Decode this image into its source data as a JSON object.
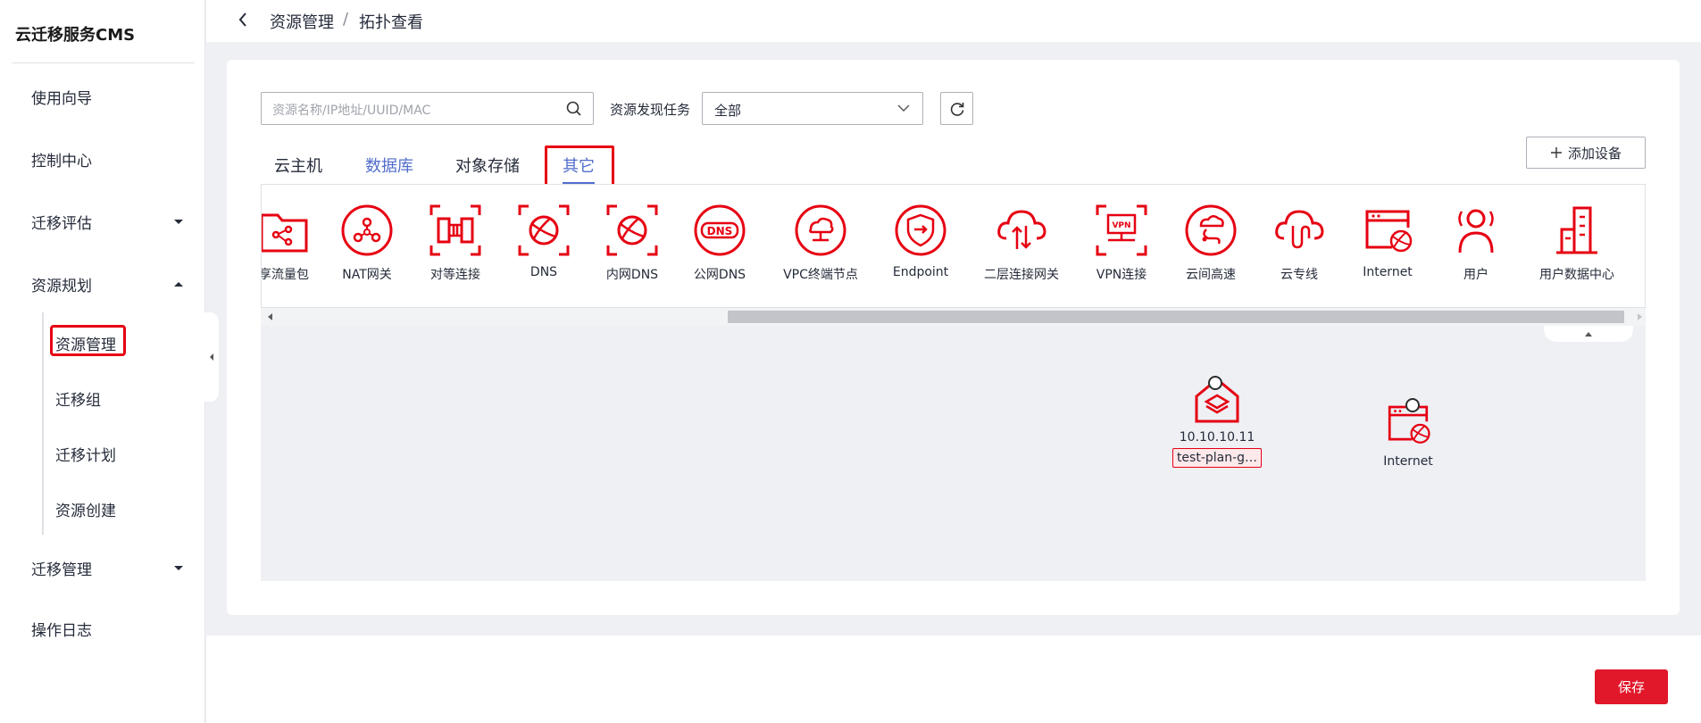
{
  "app": {
    "brand": "云迁移服务CMS"
  },
  "sidebar": {
    "items": [
      {
        "label": "使用向导"
      },
      {
        "label": "控制中心"
      },
      {
        "label": "迁移评估"
      },
      {
        "label": "资源规划"
      },
      {
        "label": "迁移管理"
      },
      {
        "label": "操作日志"
      }
    ],
    "sub_items": [
      {
        "label": "资源管理"
      },
      {
        "label": "迁移组"
      },
      {
        "label": "迁移计划"
      },
      {
        "label": "资源创建"
      }
    ]
  },
  "breadcrumb": {
    "parent": "资源管理",
    "separator": "/",
    "current": "拓扑查看"
  },
  "filters": {
    "search_placeholder": "资源名称/IP地址/UUID/MAC",
    "task_label": "资源发现任务",
    "task_value": "全部"
  },
  "tabs": [
    {
      "label": "云主机"
    },
    {
      "label": "数据库"
    },
    {
      "label": "对象存储"
    },
    {
      "label": "其它"
    }
  ],
  "add_device_label": "添加设备",
  "palette": [
    {
      "label": "享流量包",
      "icon": "folder-share-icon"
    },
    {
      "label": "NAT网关",
      "icon": "nat-gateway-icon"
    },
    {
      "label": "对等连接",
      "icon": "peering-icon"
    },
    {
      "label": "DNS",
      "icon": "dns-icon"
    },
    {
      "label": "内网DNS",
      "icon": "private-dns-icon"
    },
    {
      "label": "公网DNS",
      "icon": "public-dns-icon"
    },
    {
      "label": "VPC终端节点",
      "icon": "vpc-endpoint-icon"
    },
    {
      "label": "Endpoint",
      "icon": "endpoint-icon"
    },
    {
      "label": "二层连接网关",
      "icon": "l2-gateway-icon"
    },
    {
      "label": "VPN连接",
      "icon": "vpn-icon"
    },
    {
      "label": "云间高速",
      "icon": "cloud-connect-icon"
    },
    {
      "label": "云专线",
      "icon": "direct-connect-icon"
    },
    {
      "label": "Internet",
      "icon": "internet-icon"
    },
    {
      "label": "用户",
      "icon": "user-icon"
    },
    {
      "label": "用户数据中心",
      "icon": "datacenter-icon"
    }
  ],
  "nodes": [
    {
      "ip": "10.10.10.11",
      "name": "test-plan-g…"
    },
    {
      "name": "Internet"
    }
  ],
  "save_label": "保存",
  "colors": {
    "accent_red": "#e60012",
    "link_blue": "#526ecc",
    "save_red": "#e0182a"
  }
}
